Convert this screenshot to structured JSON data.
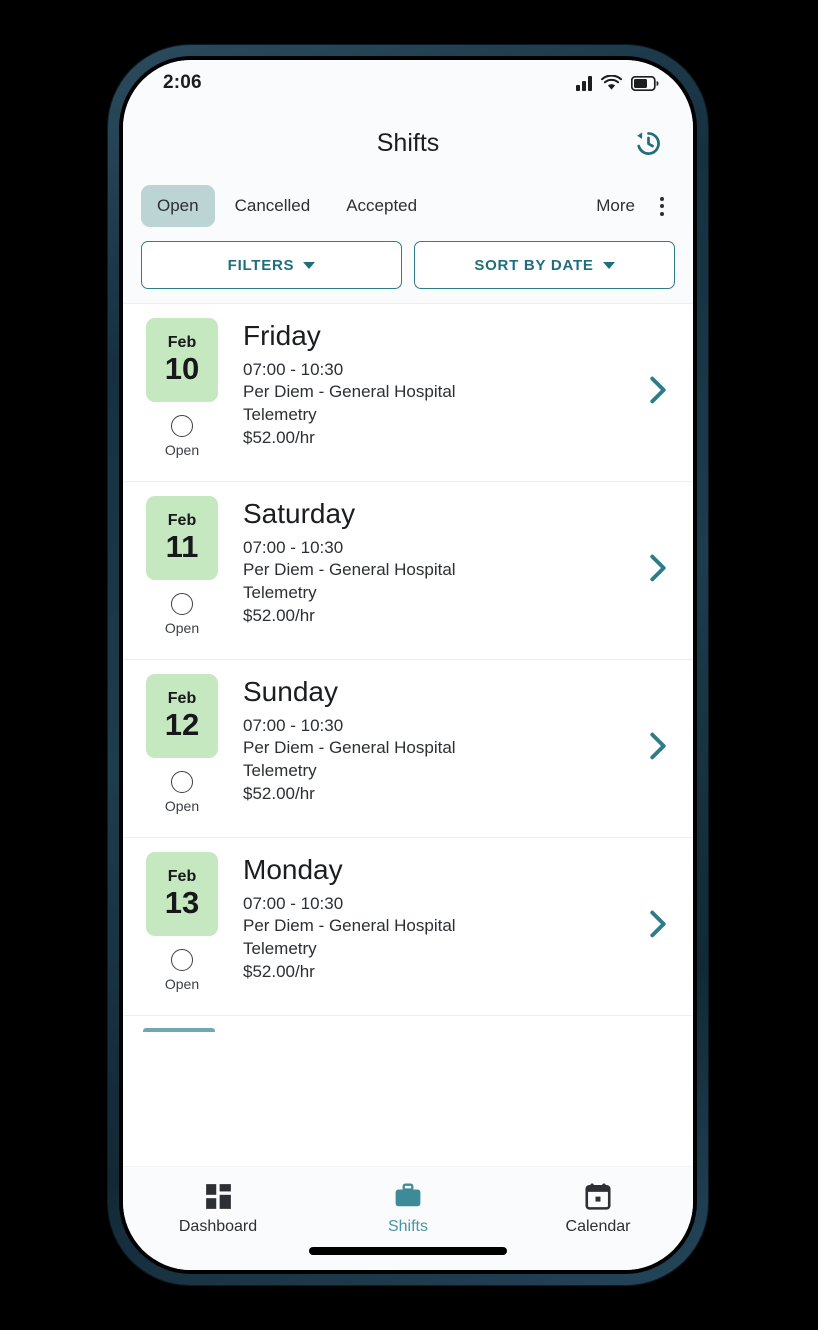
{
  "theme": {
    "accent_teal": "#1f6e7d",
    "nav_active_teal": "#4a95a4",
    "tab_active_bg": "#bdd4d4",
    "date_badge_green": "#c5e8c0",
    "screen_bg": "#fafbfc",
    "frame_navy": "#1d3c4c"
  },
  "status_bar": {
    "time": "2:06",
    "signal_icon": "cellular-signal-icon",
    "wifi_icon": "wifi-icon",
    "battery_icon": "battery-icon",
    "battery_level_pct": 65
  },
  "header": {
    "title": "Shifts",
    "history_icon": "history-icon"
  },
  "tabs": {
    "items": [
      {
        "label": "Open",
        "active": true
      },
      {
        "label": "Cancelled",
        "active": false
      },
      {
        "label": "Accepted",
        "active": false
      },
      {
        "label": "More",
        "active": false
      }
    ],
    "more_icon": "kebab-menu-icon"
  },
  "filters": {
    "filters_label": "FILTERS",
    "sort_label": "SORT BY DATE",
    "caret_icon": "chevron-down-icon"
  },
  "shifts": [
    {
      "month": "Feb",
      "day": "10",
      "weekday": "Friday",
      "time": "07:00 - 10:30",
      "facility": "Per Diem - General Hospital",
      "unit": "Telemetry",
      "rate": "$52.00/hr",
      "status": "Open",
      "chevron_icon": "chevron-right-icon"
    },
    {
      "month": "Feb",
      "day": "11",
      "weekday": "Saturday",
      "time": "07:00 - 10:30",
      "facility": "Per Diem - General Hospital",
      "unit": "Telemetry",
      "rate": "$52.00/hr",
      "status": "Open",
      "chevron_icon": "chevron-right-icon"
    },
    {
      "month": "Feb",
      "day": "12",
      "weekday": "Sunday",
      "time": "07:00 - 10:30",
      "facility": "Per Diem - General Hospital",
      "unit": "Telemetry",
      "rate": "$52.00/hr",
      "status": "Open",
      "chevron_icon": "chevron-right-icon"
    },
    {
      "month": "Feb",
      "day": "13",
      "weekday": "Monday",
      "time": "07:00 - 10:30",
      "facility": "Per Diem - General Hospital",
      "unit": "Telemetry",
      "rate": "$52.00/hr",
      "status": "Open",
      "chevron_icon": "chevron-right-icon"
    }
  ],
  "bottom_nav": {
    "items": [
      {
        "label": "Dashboard",
        "icon": "grid-dashboard-icon",
        "active": false
      },
      {
        "label": "Shifts",
        "icon": "briefcase-icon",
        "active": true
      },
      {
        "label": "Calendar",
        "icon": "calendar-icon",
        "active": false
      }
    ]
  }
}
